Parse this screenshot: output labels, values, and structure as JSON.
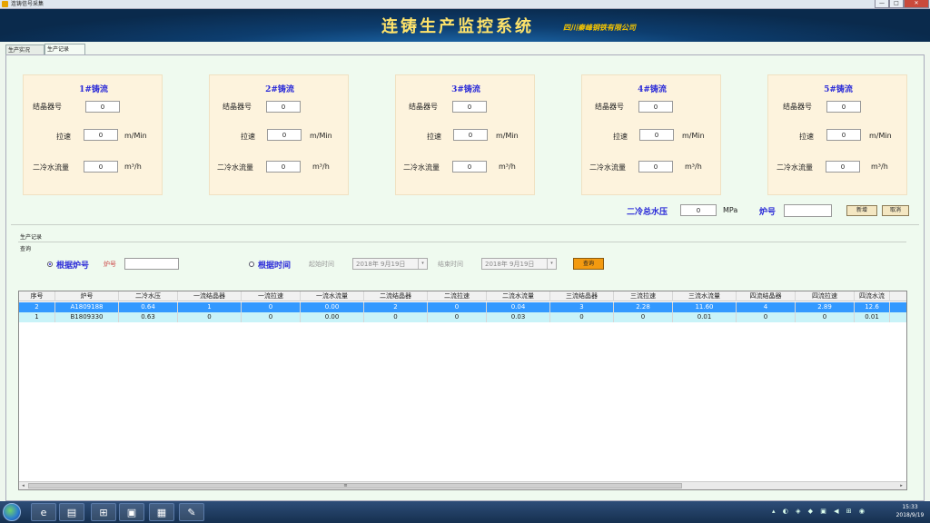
{
  "window": {
    "title": "连铸信号采集",
    "min": "—",
    "max": "□",
    "close": "✕"
  },
  "banner": {
    "title": "连铸生产监控系统",
    "subtitle": "四川秦峰钢铁有限公司"
  },
  "tabs": [
    "生产实况",
    "生产记录"
  ],
  "cards": [
    {
      "title": "1#铸流",
      "mold_label": "结晶器号",
      "mold": "0",
      "speed_label": "拉速",
      "speed": "0",
      "speed_unit": "m/Min",
      "water_label": "二冷水流量",
      "water": "0",
      "water_unit": "m³/h"
    },
    {
      "title": "2#铸流",
      "mold_label": "结晶器号",
      "mold": "0",
      "speed_label": "拉速",
      "speed": "0",
      "speed_unit": "m/Min",
      "water_label": "二冷水流量",
      "water": "0",
      "water_unit": "m³/h"
    },
    {
      "title": "3#铸流",
      "mold_label": "结晶器号",
      "mold": "0",
      "speed_label": "拉速",
      "speed": "0",
      "speed_unit": "m/Min",
      "water_label": "二冷水流量",
      "water": "0",
      "water_unit": "m³/h"
    },
    {
      "title": "4#铸流",
      "mold_label": "结晶器号",
      "mold": "0",
      "speed_label": "拉速",
      "speed": "0",
      "speed_unit": "m/Min",
      "water_label": "二冷水流量",
      "water": "0",
      "water_unit": "m³/h"
    },
    {
      "title": "5#铸流",
      "mold_label": "结晶器号",
      "mold": "0",
      "speed_label": "拉速",
      "speed": "0",
      "speed_unit": "m/Min",
      "water_label": "二冷水流量",
      "water": "0",
      "water_unit": "m³/h"
    }
  ],
  "pressure": {
    "label": "二冷总水压",
    "value": "0",
    "unit": "MPa"
  },
  "furnace": {
    "label": "炉号",
    "value": ""
  },
  "buttons": {
    "add": "新增",
    "cancel": "取消",
    "query": "查询"
  },
  "records": {
    "title": "生产记录",
    "query_title": "查询",
    "by_furnace": "根据炉号",
    "furnace_label": "炉号",
    "by_time": "根据时间",
    "start_label": "起始时间",
    "start_value": "2018年 9月19日",
    "end_label": "结束时间",
    "end_value": "2018年 9月19日",
    "dropdown": "▾"
  },
  "table": {
    "headers": [
      "序号",
      "炉号",
      "二冷水压",
      "一流结晶器",
      "一流拉速",
      "一流水流量",
      "二流结晶器",
      "二流拉速",
      "二流水流量",
      "三流结晶器",
      "三流拉速",
      "三流水流量",
      "四流结晶器",
      "四流拉速",
      "四流水流"
    ],
    "rows": [
      [
        "2",
        "A1809188",
        "0.64",
        "1",
        "0",
        "0.00",
        "2",
        "0",
        "0.04",
        "3",
        "2.28",
        "11.60",
        "4",
        "2.89",
        "12.6"
      ],
      [
        "1",
        "B1809330",
        "0.63",
        "0",
        "0",
        "0.00",
        "0",
        "0",
        "0.03",
        "0",
        "0",
        "0.01",
        "0",
        "0",
        "0.01"
      ]
    ],
    "scroll_left": "◂",
    "scroll_grip": "≡",
    "scroll_right": "▸"
  },
  "taskbar": {
    "apps": [
      "e",
      "▤",
      "⊞",
      "▣",
      "▦",
      "✎"
    ],
    "tray": "▴ ◐ ◈ ◆ ▣ ◀ ⊞ ◉",
    "time": "15:33",
    "date": "2018/9/19"
  }
}
